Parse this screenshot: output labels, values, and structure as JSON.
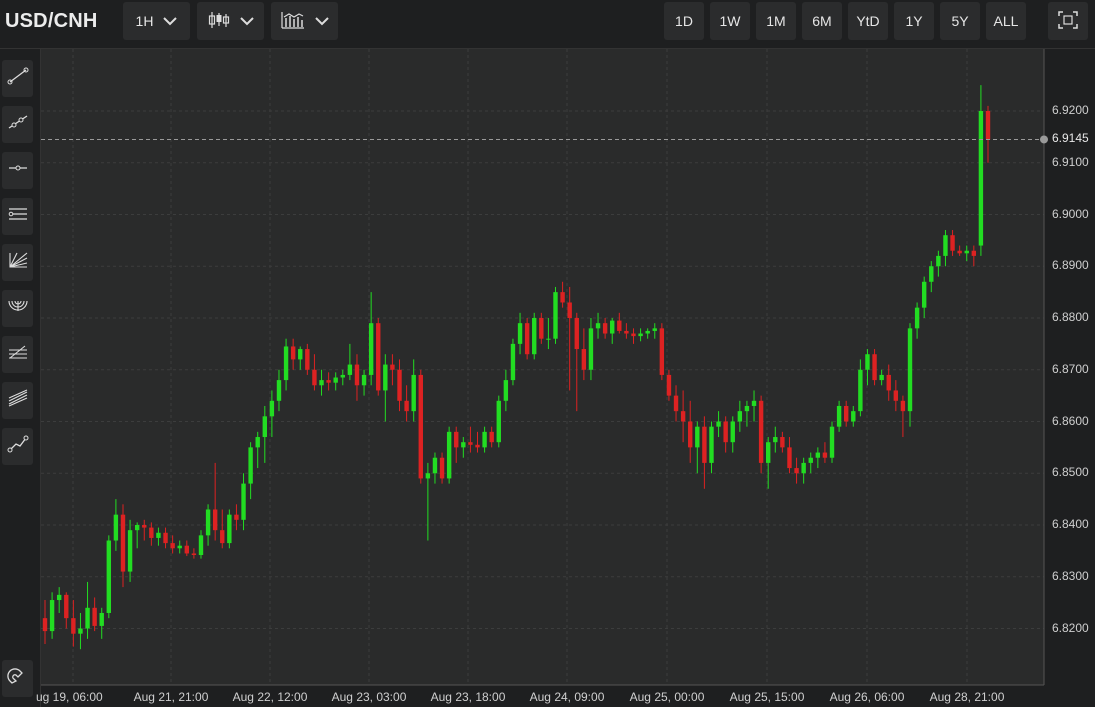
{
  "header": {
    "symbol": "USD/CNH",
    "interval": "1H",
    "ranges": [
      "1D",
      "1W",
      "1M",
      "6M",
      "YtD",
      "1Y",
      "5Y",
      "ALL"
    ]
  },
  "icons": {
    "interval_dropdown": "chevron-down-icon",
    "chart_type": "candlestick-icon",
    "indicators": "indicators-icon",
    "fullscreen": "fullscreen-icon",
    "tools": [
      "trend-line-icon",
      "ray-icon",
      "horizontal-line-icon",
      "parallel-channel-icon",
      "fib-fan-icon",
      "fib-arc-icon",
      "fib-retracement-icon",
      "pitchfork-icon",
      "polyline-icon",
      "magnet-icon"
    ]
  },
  "colors": {
    "up": "#22dd22",
    "down": "#dd2222",
    "background": "#2a2b2b",
    "grid": "#3c3d3d"
  },
  "chart_data": {
    "type": "candlestick",
    "title": "USD/CNH",
    "interval": "1H",
    "y_ticks": [
      "6.8200",
      "6.8300",
      "6.8400",
      "6.8500",
      "6.8600",
      "6.8700",
      "6.8800",
      "6.8900",
      "6.9000",
      "6.9100",
      "6.9200"
    ],
    "ylim": [
      6.814,
      6.93
    ],
    "x_labels": [
      "ug 19, 06:00",
      "Aug 21, 21:00",
      "Aug 22, 12:00",
      "Aug 23, 03:00",
      "Aug 23, 18:00",
      "Aug 24, 09:00",
      "Aug 25, 00:00",
      "Aug 25, 15:00",
      "Aug 26, 06:00",
      "Aug 28, 21:00"
    ],
    "last_price": 6.9145,
    "last_price_label": "6.9145",
    "grid": true,
    "candles": [
      [
        6.822,
        6.8255,
        6.817,
        6.8195
      ],
      [
        6.8195,
        6.827,
        6.818,
        6.8255
      ],
      [
        6.8255,
        6.828,
        6.823,
        6.8265
      ],
      [
        6.8265,
        6.827,
        6.82,
        6.822
      ],
      [
        6.822,
        6.8255,
        6.8165,
        6.819
      ],
      [
        6.819,
        6.823,
        6.816,
        6.82
      ],
      [
        6.82,
        6.829,
        6.818,
        6.824
      ],
      [
        6.824,
        6.826,
        6.8195,
        6.8205
      ],
      [
        6.8205,
        6.824,
        6.818,
        6.823
      ],
      [
        6.823,
        6.838,
        6.822,
        6.837
      ],
      [
        6.837,
        6.845,
        6.835,
        6.842
      ],
      [
        6.842,
        6.844,
        6.828,
        6.831
      ],
      [
        6.831,
        6.841,
        6.829,
        6.839
      ],
      [
        6.839,
        6.8405,
        6.8355,
        6.84
      ],
      [
        6.84,
        6.841,
        6.837,
        6.8395
      ],
      [
        6.8395,
        6.8405,
        6.836,
        6.8375
      ],
      [
        6.8375,
        6.8395,
        6.836,
        6.8385
      ],
      [
        6.8385,
        6.8395,
        6.8355,
        6.8365
      ],
      [
        6.8365,
        6.838,
        6.8345,
        6.8355
      ],
      [
        6.8355,
        6.837,
        6.8345,
        6.836
      ],
      [
        6.836,
        6.837,
        6.834,
        6.8345
      ],
      [
        6.8345,
        6.8355,
        6.8335,
        6.8342
      ],
      [
        6.8342,
        6.839,
        6.8335,
        6.838
      ],
      [
        6.838,
        6.844,
        6.836,
        6.843
      ],
      [
        6.843,
        6.852,
        6.837,
        6.839
      ],
      [
        6.839,
        6.843,
        6.8355,
        6.8365
      ],
      [
        6.8365,
        6.843,
        6.8355,
        6.842
      ],
      [
        6.842,
        6.844,
        6.839,
        6.841
      ],
      [
        6.841,
        6.85,
        6.839,
        6.848
      ],
      [
        6.848,
        6.856,
        6.845,
        6.855
      ],
      [
        6.855,
        6.858,
        6.851,
        6.857
      ],
      [
        6.857,
        6.863,
        6.852,
        6.861
      ],
      [
        6.861,
        6.866,
        6.857,
        6.864
      ],
      [
        6.864,
        6.87,
        6.862,
        6.868
      ],
      [
        6.868,
        6.876,
        6.866,
        6.8745
      ],
      [
        6.8745,
        6.876,
        6.87,
        6.872
      ],
      [
        6.872,
        6.8745,
        6.87,
        6.874
      ],
      [
        6.874,
        6.875,
        6.869,
        6.87
      ],
      [
        6.87,
        6.873,
        6.866,
        6.867
      ],
      [
        6.867,
        6.87,
        6.865,
        6.868
      ],
      [
        6.868,
        6.8695,
        6.866,
        6.8675
      ],
      [
        6.8675,
        6.8695,
        6.866,
        6.8685
      ],
      [
        6.8685,
        6.87,
        6.867,
        6.869
      ],
      [
        6.869,
        6.875,
        6.868,
        6.871
      ],
      [
        6.871,
        6.873,
        6.864,
        6.867
      ],
      [
        6.867,
        6.87,
        6.865,
        6.869
      ],
      [
        6.869,
        6.885,
        6.867,
        6.879
      ],
      [
        6.879,
        6.88,
        6.865,
        6.866
      ],
      [
        6.866,
        6.873,
        6.86,
        6.871
      ],
      [
        6.871,
        6.873,
        6.867,
        6.87
      ],
      [
        6.87,
        6.872,
        6.862,
        6.864
      ],
      [
        6.864,
        6.867,
        6.86,
        6.862
      ],
      [
        6.862,
        6.872,
        6.86,
        6.869
      ],
      [
        6.869,
        6.87,
        6.848,
        6.849
      ],
      [
        6.849,
        6.852,
        6.837,
        6.85
      ],
      [
        6.85,
        6.854,
        6.848,
        6.853
      ],
      [
        6.853,
        6.854,
        6.848,
        6.849
      ],
      [
        6.849,
        6.859,
        6.848,
        6.858
      ],
      [
        6.858,
        6.859,
        6.852,
        6.855
      ],
      [
        6.855,
        6.857,
        6.853,
        6.856
      ],
      [
        6.856,
        6.859,
        6.854,
        6.8555
      ],
      [
        6.8555,
        6.858,
        6.854,
        6.855
      ],
      [
        6.855,
        6.859,
        6.854,
        6.858
      ],
      [
        6.858,
        6.859,
        6.855,
        6.856
      ],
      [
        6.856,
        6.865,
        6.855,
        6.864
      ],
      [
        6.864,
        6.87,
        6.862,
        6.868
      ],
      [
        6.868,
        6.876,
        6.867,
        6.875
      ],
      [
        6.875,
        6.881,
        6.873,
        6.879
      ],
      [
        6.879,
        6.88,
        6.872,
        6.873
      ],
      [
        6.873,
        6.881,
        6.872,
        6.88
      ],
      [
        6.88,
        6.881,
        6.875,
        6.876
      ],
      [
        6.876,
        6.88,
        6.874,
        6.876
      ],
      [
        6.876,
        6.886,
        6.875,
        6.885
      ],
      [
        6.885,
        6.887,
        6.882,
        6.883
      ],
      [
        6.883,
        6.886,
        6.866,
        6.88
      ],
      [
        6.88,
        6.881,
        6.862,
        6.874
      ],
      [
        6.874,
        6.878,
        6.868,
        6.87
      ],
      [
        6.87,
        6.88,
        6.868,
        6.878
      ],
      [
        6.878,
        6.881,
        6.876,
        6.879
      ],
      [
        6.879,
        6.88,
        6.876,
        6.877
      ],
      [
        6.877,
        6.88,
        6.875,
        6.8795
      ],
      [
        6.8795,
        6.881,
        6.877,
        6.8775
      ],
      [
        6.8775,
        6.879,
        6.876,
        6.877
      ],
      [
        6.877,
        6.878,
        6.875,
        6.8765
      ],
      [
        6.8765,
        6.878,
        6.8755,
        6.877
      ],
      [
        6.877,
        6.878,
        6.876,
        6.8775
      ],
      [
        6.8775,
        6.879,
        6.876,
        6.878
      ],
      [
        6.878,
        6.879,
        6.868,
        6.869
      ],
      [
        6.869,
        6.87,
        6.864,
        6.865
      ],
      [
        6.865,
        6.867,
        6.86,
        6.862
      ],
      [
        6.862,
        6.866,
        6.856,
        6.86
      ],
      [
        6.86,
        6.864,
        6.852,
        6.855
      ],
      [
        6.855,
        6.86,
        6.85,
        6.859
      ],
      [
        6.859,
        6.861,
        6.847,
        6.852
      ],
      [
        6.852,
        6.86,
        6.85,
        6.859
      ],
      [
        6.859,
        6.862,
        6.857,
        6.86
      ],
      [
        6.86,
        6.861,
        6.854,
        6.856
      ],
      [
        6.856,
        6.861,
        6.854,
        6.86
      ],
      [
        6.86,
        6.864,
        6.858,
        6.862
      ],
      [
        6.862,
        6.864,
        6.859,
        6.863
      ],
      [
        6.863,
        6.866,
        6.86,
        6.864
      ],
      [
        6.864,
        6.865,
        6.85,
        6.852
      ],
      [
        6.852,
        6.857,
        6.847,
        6.856
      ],
      [
        6.856,
        6.859,
        6.854,
        6.857
      ],
      [
        6.857,
        6.858,
        6.854,
        6.855
      ],
      [
        6.855,
        6.857,
        6.85,
        6.851
      ],
      [
        6.851,
        6.853,
        6.848,
        6.85
      ],
      [
        6.85,
        6.853,
        6.848,
        6.852
      ],
      [
        6.852,
        6.854,
        6.85,
        6.853
      ],
      [
        6.853,
        6.855,
        6.851,
        6.854
      ],
      [
        6.854,
        6.856,
        6.852,
        6.853
      ],
      [
        6.853,
        6.86,
        6.852,
        6.859
      ],
      [
        6.859,
        6.864,
        6.858,
        6.863
      ],
      [
        6.863,
        6.864,
        6.859,
        6.86
      ],
      [
        6.86,
        6.863,
        6.859,
        6.862
      ],
      [
        6.862,
        6.872,
        6.861,
        6.87
      ],
      [
        6.87,
        6.874,
        6.867,
        6.873
      ],
      [
        6.873,
        6.874,
        6.867,
        6.868
      ],
      [
        6.868,
        6.87,
        6.867,
        6.869
      ],
      [
        6.869,
        6.871,
        6.864,
        6.866
      ],
      [
        6.866,
        6.868,
        6.862,
        6.864
      ],
      [
        6.864,
        6.865,
        6.857,
        6.862
      ],
      [
        6.862,
        6.879,
        6.859,
        6.878
      ],
      [
        6.878,
        6.883,
        6.876,
        6.882
      ],
      [
        6.882,
        6.888,
        6.88,
        6.887
      ],
      [
        6.887,
        6.891,
        6.885,
        6.89
      ],
      [
        6.89,
        6.893,
        6.888,
        6.892
      ],
      [
        6.892,
        6.897,
        6.89,
        6.896
      ],
      [
        6.896,
        6.897,
        6.892,
        6.893
      ],
      [
        6.893,
        6.894,
        6.892,
        6.8925
      ],
      [
        6.8925,
        6.894,
        6.891,
        6.893
      ],
      [
        6.893,
        6.894,
        6.89,
        6.892
      ],
      [
        6.894,
        6.925,
        6.892,
        6.92
      ],
      [
        6.92,
        6.921,
        6.91,
        6.9145
      ]
    ]
  }
}
